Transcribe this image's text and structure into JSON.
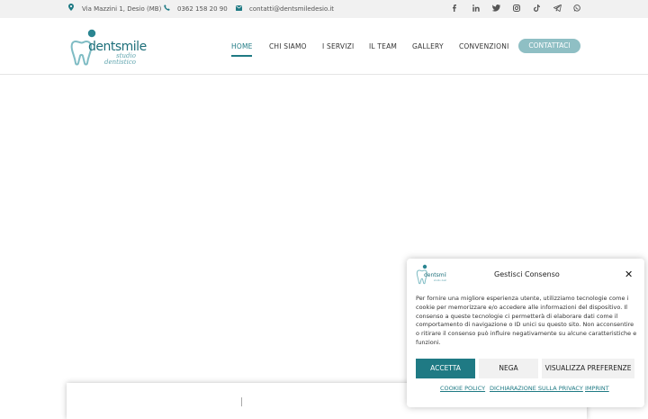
{
  "topbar": {
    "address": "Via Mazzini 1, Desio (MB)",
    "phone": "0362 158 20 90",
    "email": "contatti@dentsmiledesio.it",
    "social": [
      "facebook",
      "linkedin",
      "twitter",
      "instagram",
      "tiktok",
      "telegram",
      "whatsapp"
    ]
  },
  "header": {
    "logo": {
      "name": "dentsmile",
      "sub1": "studio",
      "sub2": "dentistico"
    },
    "nav": [
      "HOME",
      "CHI SIAMO",
      "I SERVIZI",
      "IL TEAM",
      "GALLERY",
      "CONVENZIONI"
    ],
    "cta": "CONTATTACI"
  },
  "consent": {
    "title": "Gestisci Consenso",
    "body": "Per fornire una migliore esperienza utente, utilizziamo tecnologie come i cookie per memorizzare e/o accedere alle informazioni del dispositivo. Il consenso a queste tecnologie ci permetterà di elaborare dati come il comportamento di navigazione o ID unici su questo sito. Non acconsentire o ritirare il consenso può influire negativamente su alcune caratteristiche e funzioni.",
    "accept": "ACCETTA",
    "deny": "NEGA",
    "preferences": "VISUALIZZA PREFERENZE",
    "links": [
      "COOKIE POLICY",
      "DICHIARAZIONE SULLA PRIVACY",
      "IMPRINT"
    ]
  },
  "colors": {
    "accent": "#1f7a84",
    "cta": "#8fbfc4",
    "topbar": "#f1f1f1"
  }
}
